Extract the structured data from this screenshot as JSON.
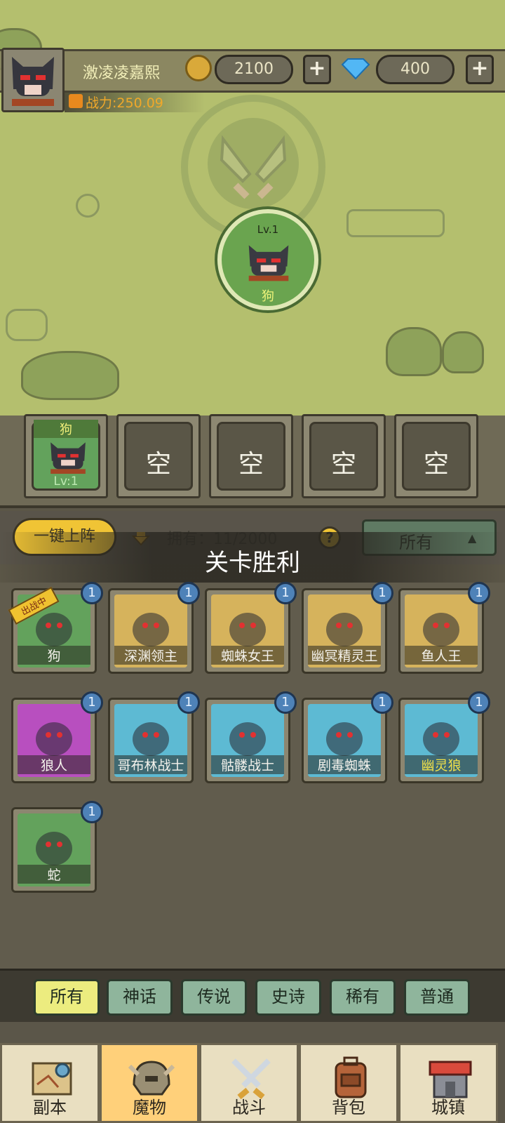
{
  "player": {
    "name": "激凌凌嘉熙",
    "power": "战力:250.09",
    "gold": "2100",
    "diamonds": "400",
    "gold_plus": "+",
    "diamond_plus": "+"
  },
  "map": {
    "node_level": "Lv.1",
    "node_name": "狗"
  },
  "formation": {
    "slots": [
      {
        "name": "狗",
        "level": "Lv:1"
      },
      {
        "empty": "空"
      },
      {
        "empty": "空"
      },
      {
        "empty": "空"
      },
      {
        "empty": "空"
      }
    ]
  },
  "controls": {
    "quick_deploy": "一键上阵",
    "owned": "拥有：11/2000",
    "help": "?",
    "filter": "所有",
    "victory": "关卡胜利"
  },
  "monsters": [
    {
      "name": "狗",
      "count": "1",
      "deployed": "出战中",
      "color": "#63a25c"
    },
    {
      "name": "深渊领主",
      "count": "1",
      "color": "#d6b35c"
    },
    {
      "name": "蜘蛛女王",
      "count": "1",
      "color": "#d6b35c"
    },
    {
      "name": "幽冥精灵王",
      "count": "1",
      "color": "#d6b35c"
    },
    {
      "name": "鱼人王",
      "count": "1",
      "color": "#d6b35c"
    },
    {
      "name": "狼人",
      "count": "1",
      "color": "#b84fbf"
    },
    {
      "name": "哥布林战士",
      "count": "1",
      "color": "#5dbad3"
    },
    {
      "name": "骷髅战士",
      "count": "1",
      "color": "#5dbad3"
    },
    {
      "name": "剧毒蜘蛛",
      "count": "1",
      "color": "#5dbad3"
    },
    {
      "name": "幽灵狼",
      "count": "1",
      "color": "#5dbad3",
      "name_color": "#f0e04a"
    },
    {
      "name": "蛇",
      "count": "1",
      "color": "#63a25c"
    }
  ],
  "rarity_tabs": [
    "所有",
    "神话",
    "传说",
    "史诗",
    "稀有",
    "普通"
  ],
  "nav": [
    "副本",
    "魔物",
    "战斗",
    "背包",
    "城镇"
  ]
}
